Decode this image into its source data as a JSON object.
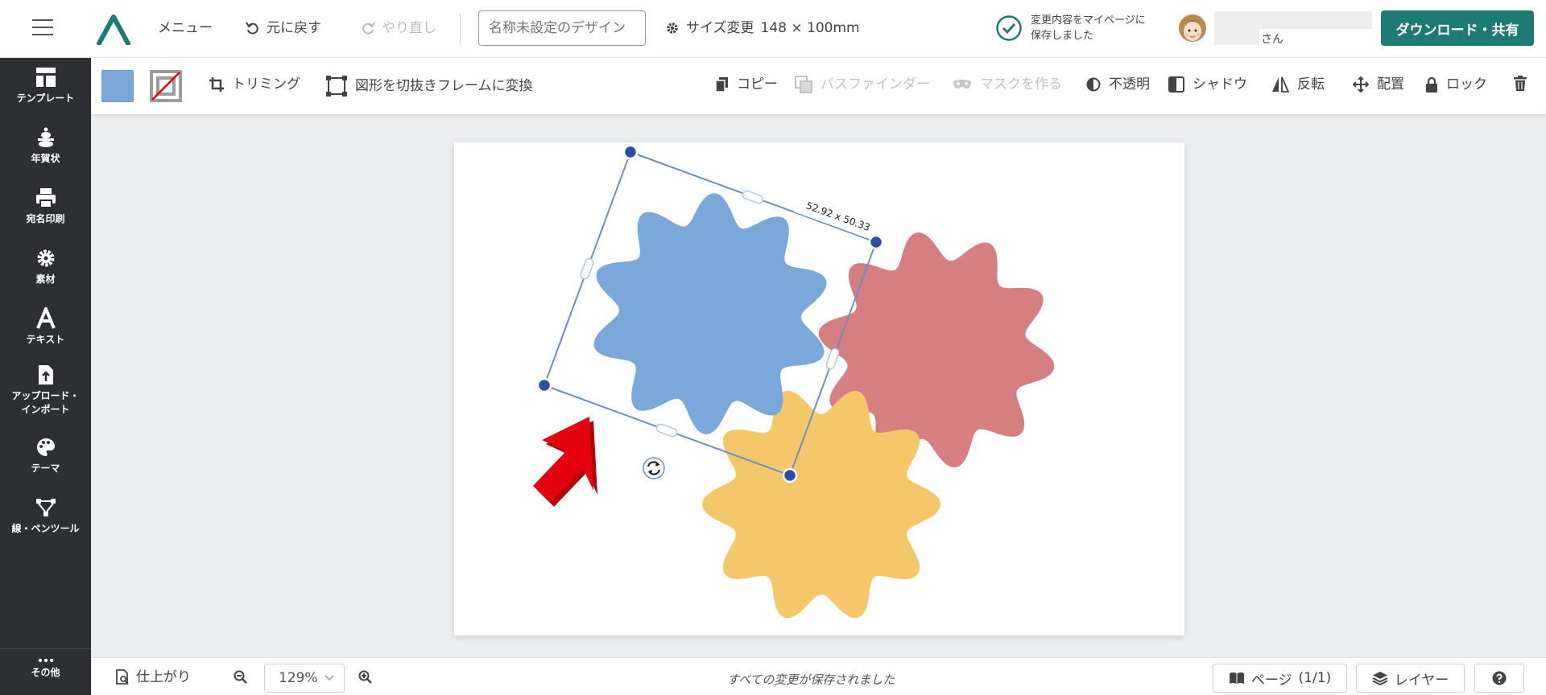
{
  "topbar": {
    "menu_label": "メニュー",
    "undo_label": "元に戻す",
    "redo_label": "やり直し",
    "title_placeholder": "名称未設定のデザイン",
    "size_label": "サイズ変更",
    "size_value": "148 × 100mm",
    "saved_line1": "変更内容をマイページに",
    "saved_line2": "保存しました",
    "user_suffix": "さん",
    "download_label": "ダウンロード・共有"
  },
  "sidebar": {
    "items": [
      {
        "label": "テンプレート",
        "icon": "template-icon"
      },
      {
        "label": "年賀状",
        "icon": "new-year-card-icon"
      },
      {
        "label": "宛名印刷",
        "icon": "printer-icon"
      },
      {
        "label": "素材",
        "icon": "gear-icon"
      },
      {
        "label": "テキスト",
        "icon": "text-icon"
      },
      {
        "label": "アップロード・インポート",
        "icon": "upload-icon"
      },
      {
        "label": "テーマ",
        "icon": "palette-icon"
      },
      {
        "label": "線・ペンツール",
        "icon": "pen-tool-icon"
      }
    ],
    "more_label": "その他"
  },
  "toolbar": {
    "fill_color": "#7aa8db",
    "trim_label": "トリミング",
    "frame_label": "図形を切抜きフレームに変換",
    "copy_label": "コピー",
    "pathfinder_label": "パスファインダー",
    "mask_label": "マスクを作る",
    "opacity_label": "不透明",
    "shadow_label": "シャドウ",
    "flip_label": "反転",
    "arrange_label": "配置",
    "lock_label": "ロック"
  },
  "canvas": {
    "dimension_label": "52.92 x 50.33",
    "colors": {
      "blue_shape": "#7aa8db",
      "red_shape": "#d57f81",
      "yellow_shape": "#f4c76b",
      "selection": "#6b8fc4",
      "handle": "#2a4fa3",
      "arrow": "#e3000f"
    }
  },
  "bottombar": {
    "preview_label": "仕上がり",
    "zoom_value": "129%",
    "save_message": "すべての変更が保存されました",
    "page_label": "ページ",
    "page_count": "(1/1)",
    "layer_label": "レイヤー"
  }
}
